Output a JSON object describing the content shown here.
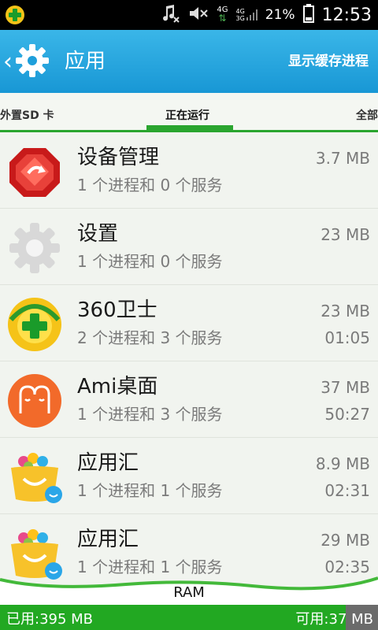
{
  "status_bar": {
    "network": "4G",
    "network_small_top": "4G",
    "network_small_bottom": "3G",
    "battery": "21%",
    "time": "12:53"
  },
  "header": {
    "title": "应用",
    "action": "显示缓存进程"
  },
  "tabs": {
    "sd": "外置SD 卡",
    "running": "正在运行",
    "all": "全部"
  },
  "apps": [
    {
      "name": "设备管理",
      "desc": "1 个进程和 0 个服务",
      "size": "3.7 MB",
      "time": ""
    },
    {
      "name": "设置",
      "desc": "1 个进程和 0 个服务",
      "size": "23 MB",
      "time": ""
    },
    {
      "name": " 360卫士",
      "desc": "2 个进程和 3 个服务",
      "size": "23 MB",
      "time": "01:05"
    },
    {
      "name": "Ami桌面",
      "desc": "1 个进程和 3 个服务",
      "size": "37 MB",
      "time": "50:27"
    },
    {
      "name": "应用汇",
      "desc": "1 个进程和 1 个服务",
      "size": "8.9 MB",
      "time": "02:31"
    },
    {
      "name": "应用汇",
      "desc": "1 个进程和 1 个服务",
      "size": "29 MB",
      "time": "02:35"
    }
  ],
  "ram": {
    "label": "RAM",
    "used": "已用:395 MB",
    "available": "可用:37 MB",
    "used_fraction": 0.914
  },
  "colors": {
    "header": "#1ea3de",
    "accent_green": "#2aa52f",
    "ram_used": "#22a822",
    "ram_free": "#6b6b6b"
  }
}
